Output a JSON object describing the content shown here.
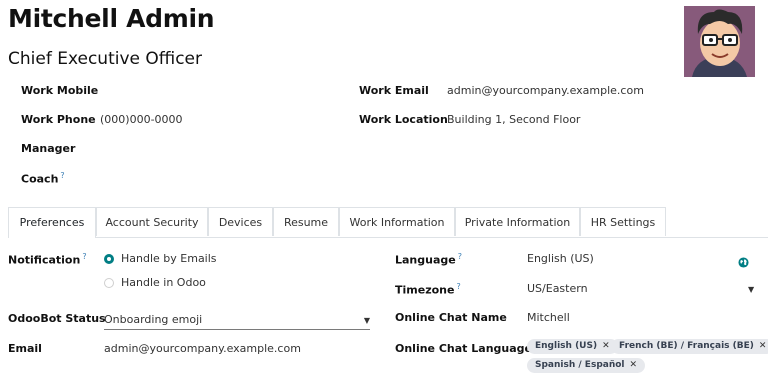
{
  "employee": {
    "name": "Mitchell Admin",
    "job_title": "Chief Executive Officer"
  },
  "fields": {
    "work_mobile": {
      "label": "Work Mobile",
      "value": ""
    },
    "work_phone": {
      "label": "Work Phone",
      "value": "(000)000-0000"
    },
    "manager": {
      "label": "Manager",
      "value": ""
    },
    "coach": {
      "label": "Coach",
      "help": "?",
      "value": ""
    },
    "work_email": {
      "label": "Work Email",
      "value": "admin@yourcompany.example.com"
    },
    "work_location": {
      "label": "Work Location",
      "value": "Building 1, Second Floor"
    }
  },
  "tabs": [
    {
      "label": "Preferences",
      "active": true
    },
    {
      "label": "Account Security"
    },
    {
      "label": "Devices"
    },
    {
      "label": "Resume"
    },
    {
      "label": "Work Information"
    },
    {
      "label": "Private Information"
    },
    {
      "label": "HR Settings"
    }
  ],
  "preferences": {
    "notification": {
      "label": "Notification",
      "help": "?",
      "options": [
        "Handle by Emails",
        "Handle in Odoo"
      ],
      "selected": "Handle by Emails"
    },
    "odoobot_status": {
      "label": "OdooBot Status",
      "value": "Onboarding emoji"
    },
    "email": {
      "label": "Email",
      "value": "admin@yourcompany.example.com"
    },
    "language": {
      "label": "Language",
      "help": "?",
      "value": "English (US)"
    },
    "timezone": {
      "label": "Timezone",
      "help": "?",
      "value": "US/Eastern"
    },
    "online_chat_name": {
      "label": "Online Chat Name",
      "value": "Mitchell"
    },
    "online_chat_language": {
      "label": "Online Chat Language",
      "tags": [
        "English (US)",
        "French (BE) / Français (BE)",
        "Spanish / Español"
      ],
      "remove_glyph": "✕"
    }
  },
  "icons": {
    "globe": "globe-icon",
    "caret": "caret-down-icon",
    "avatar": "avatar-illustration"
  },
  "colors": {
    "accent": "#017e84",
    "help": "#3c7fb5",
    "avatar_bg": "#875a7b",
    "tag_bg": "#e7e9ed"
  }
}
